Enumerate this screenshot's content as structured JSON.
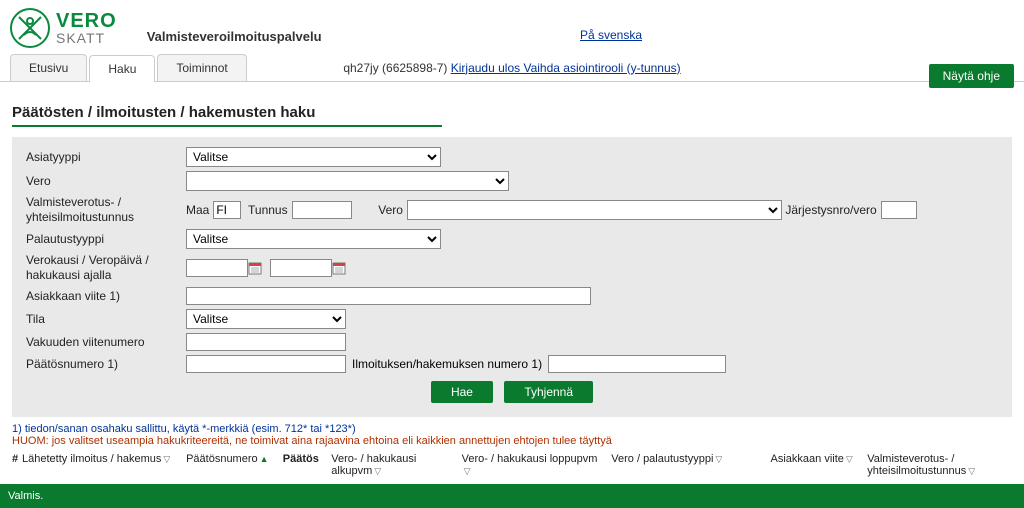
{
  "logo": {
    "vero": "VERO",
    "skatt": "SKATT"
  },
  "service_title": "Valmisteveroilmoituspalvelu",
  "lang_link": "På svenska",
  "tabs": [
    "Etusivu",
    "Haku",
    "Toiminnot"
  ],
  "user_str": "qh27jy (6625898-7) ",
  "logout_link": "Kirjaudu ulos Vaihda asiointirooli (y-tunnus)",
  "show_help": "Näytä ohje",
  "page_title": "Päätösten / ilmoitusten / hakemusten haku",
  "labels": {
    "asiatyyppi": "Asiatyyppi",
    "vero": "Vero",
    "valmiste": "Valmisteverotus- / yhteisilmoitustunnus",
    "palautus": "Palautustyyppi",
    "verokausi": "Verokausi / Veropäivä / hakukausi ajalla",
    "asiakkaan_viite": "Asiakkaan viite 1)",
    "tila": "Tila",
    "vakuuden": "Vakuuden viitenumero",
    "paatosnum": "Päätösnumero 1)",
    "maa": "Maa",
    "tunnus": "Tunnus",
    "vero_sub": "Vero",
    "jarjestys": "Järjestysnro/vero",
    "ilmoitus_num": "Ilmoituksen/hakemuksen numero 1)"
  },
  "select_placeholder": "Valitse",
  "maa_value": "FI",
  "btn_hae": "Hae",
  "btn_tyhjenna": "Tyhjennä",
  "hint": "1) tiedon/sanan osahaku sallittu, käytä *-merkkiä (esim. 712* tai *123*)",
  "note": "HUOM: jos valitset useampia hakukriteereitä, ne toimivat aina rajaavina ehtoina eli kaikkien annettujen ehtojen tulee täyttyä",
  "cols": {
    "hash": "#",
    "lahetetty": "Lähetetty ilmoitus / hakemus",
    "paatosnum": "Päätösnumero",
    "paatos": "Päätös",
    "alkupvm": "Vero- / hakukausi alkupvm",
    "loppupvm": "Vero- / hakukausi loppupvm",
    "veropal": "Vero / palautustyyppi",
    "viite": "Asiakkaan viite",
    "valmiste": "Valmisteverotus- / yhteisilmoitustunnus"
  },
  "footer": "Valmis."
}
